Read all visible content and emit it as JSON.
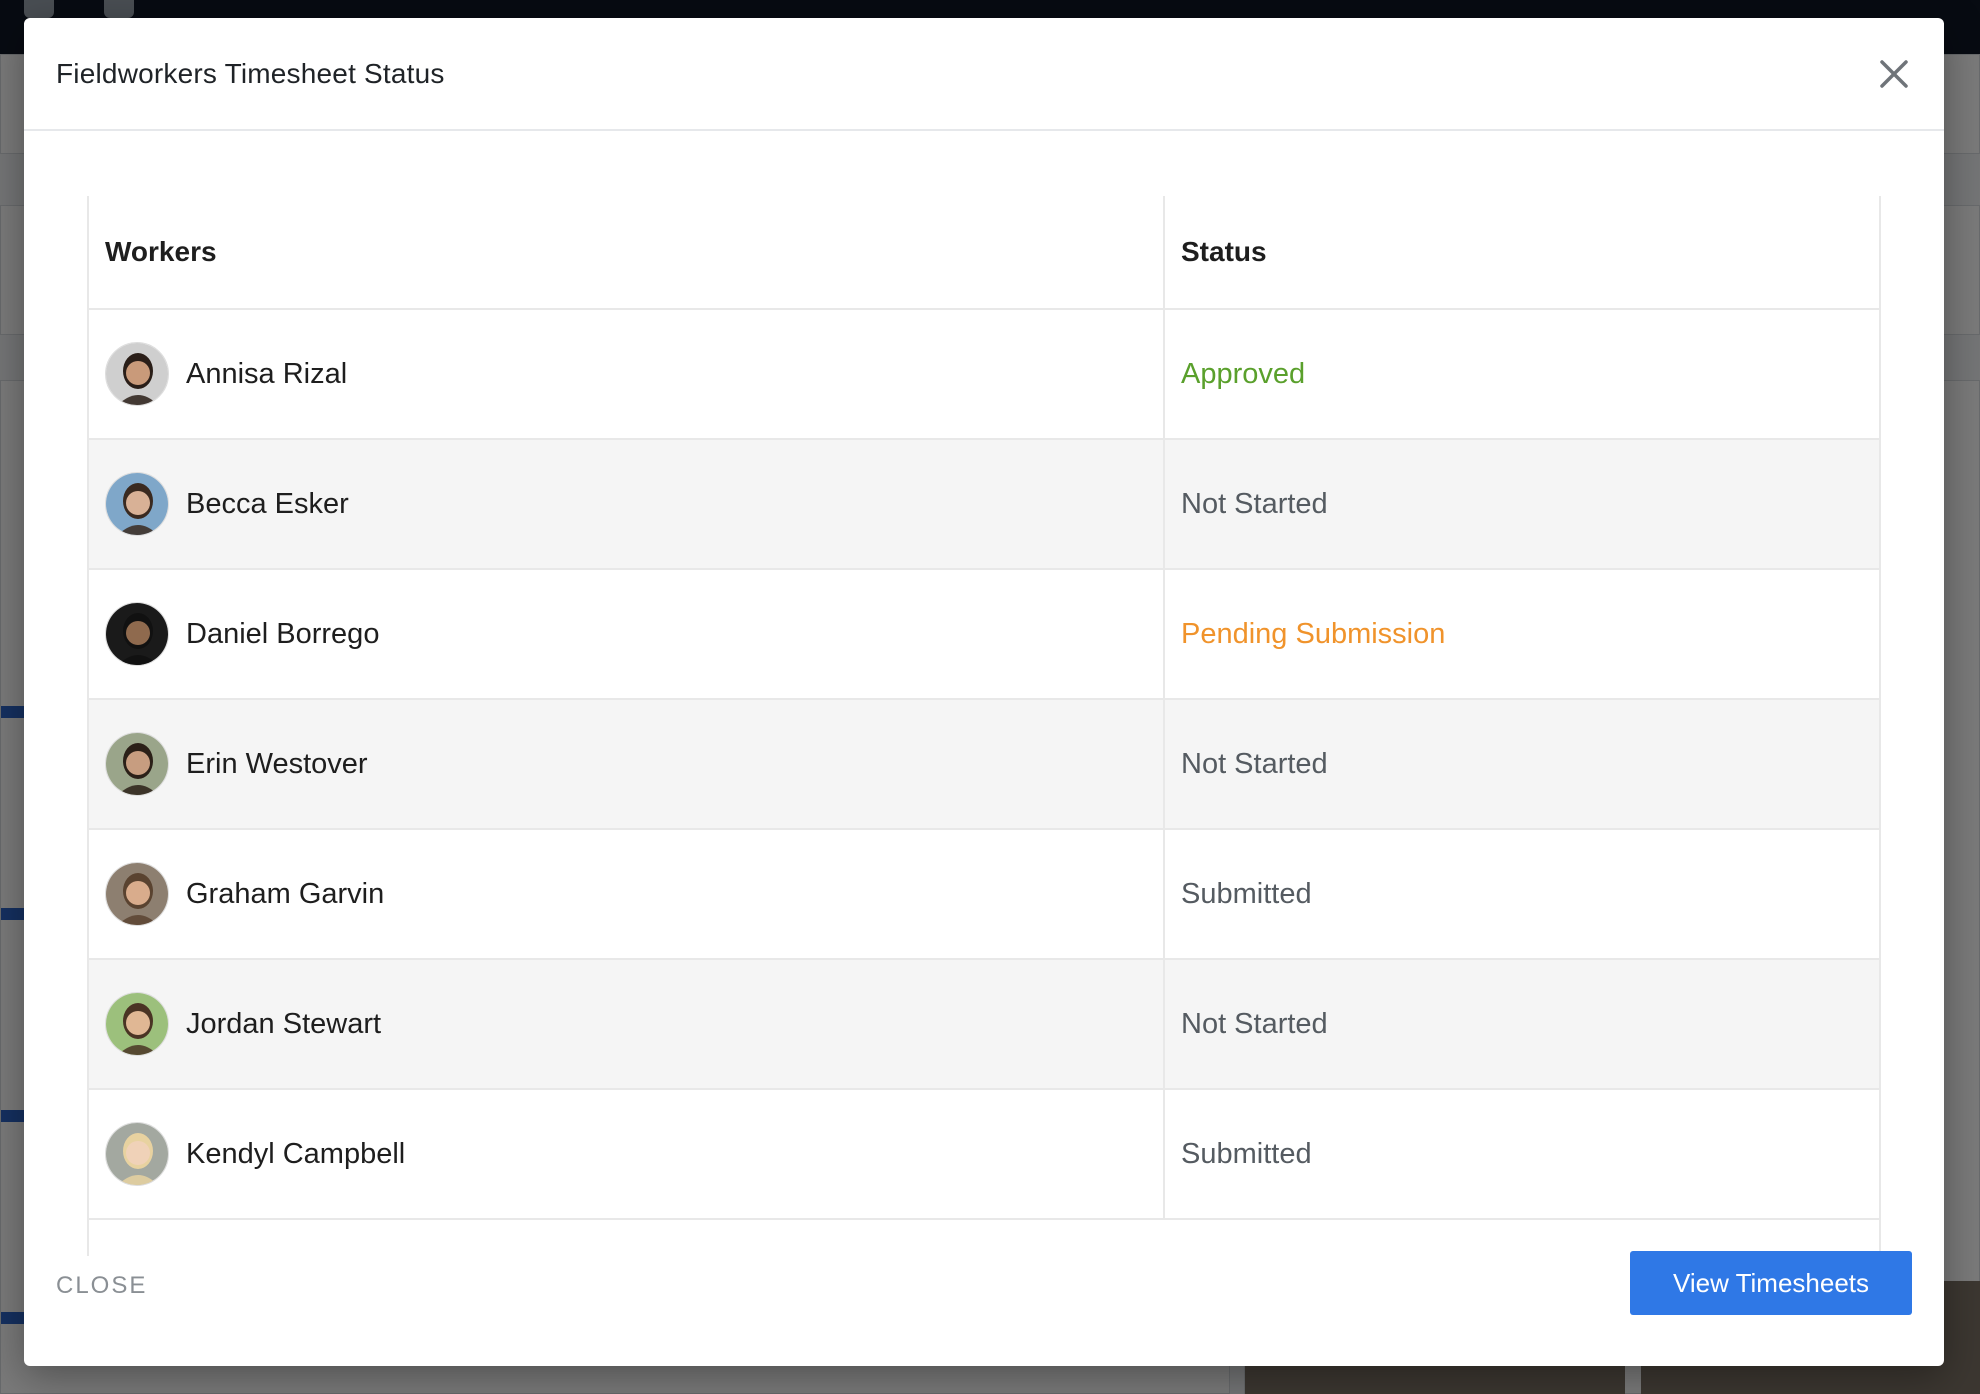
{
  "modal": {
    "title": "Fieldworkers Timesheet Status",
    "close_footer_label": "CLOSE",
    "primary_button_label": "View Timesheets"
  },
  "table": {
    "headers": {
      "workers": "Workers",
      "status": "Status"
    },
    "rows": [
      {
        "name": "Annisa Rizal",
        "status": "Approved",
        "status_color": "#5aa02c",
        "avatar": "person-photo-icon"
      },
      {
        "name": "Becca Esker",
        "status": "Not Started",
        "status_color": "#555b61",
        "avatar": "person-photo-icon"
      },
      {
        "name": "Daniel Borrego",
        "status": "Pending Submission",
        "status_color": "#f0932b",
        "avatar": "person-photo-icon"
      },
      {
        "name": "Erin Westover",
        "status": "Not Started",
        "status_color": "#555b61",
        "avatar": "person-photo-icon"
      },
      {
        "name": "Graham Garvin",
        "status": "Submitted",
        "status_color": "#555b61",
        "avatar": "person-photo-icon"
      },
      {
        "name": "Jordan Stewart",
        "status": "Not Started",
        "status_color": "#555b61",
        "avatar": "person-photo-icon"
      },
      {
        "name": "Kendyl Campbell",
        "status": "Submitted",
        "status_color": "#555b61",
        "avatar": "person-photo-icon"
      }
    ]
  },
  "colors": {
    "primary": "#2f78e6",
    "approved": "#5aa02c",
    "pending": "#f0932b",
    "neutral_status": "#555b61"
  }
}
